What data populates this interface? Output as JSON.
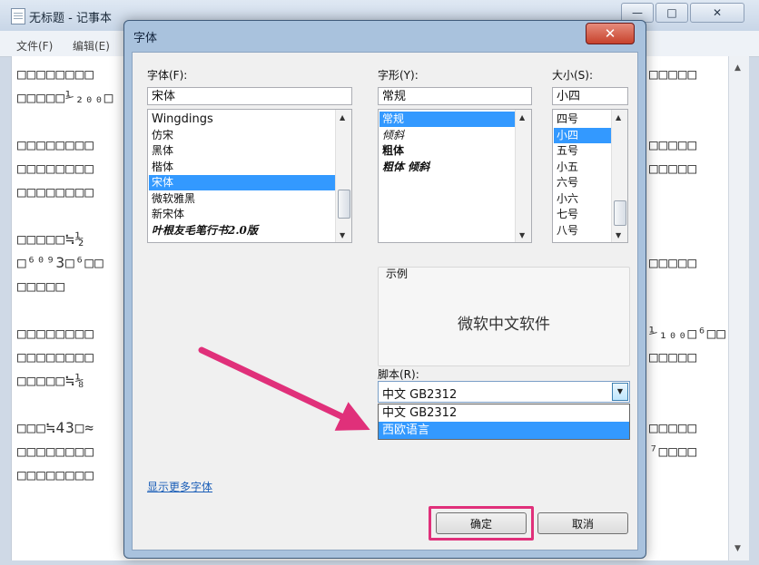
{
  "notepad": {
    "title": "无标题 - 记事本",
    "menu": [
      "文件(F)",
      "编辑(E)"
    ],
    "controls": {
      "minimize": "—",
      "maximize": "□",
      "close": "✕"
    },
    "left_lines": [
      "□□□□□□□□",
      "□□□□□⅟₂₀₀□",
      "",
      "□□□□□□□□",
      "□□□□□□□□",
      "□□□□□□□□",
      "",
      "□□□□□≒½",
      "□⁶⁰⁹3□⁶□□",
      "□□□□□",
      "",
      "□□□□□□□□",
      "□□□□□□□□",
      "□□□□□≒⅛",
      "",
      "□□□≒43□≈",
      "□□□□□□□□",
      "□□□□□□□□"
    ],
    "right_lines": [
      "□□□□□",
      "",
      "",
      "□□□□□",
      "□□□□□",
      "",
      "",
      "",
      "□□□□□",
      "",
      "",
      "⅟₁₀₀□⁶□□",
      "□□□□□",
      "",
      "",
      "□□□□□",
      "⁷□□□□",
      ""
    ]
  },
  "dialog": {
    "title": "字体",
    "close_label": "✕",
    "font": {
      "label": "字体(F):",
      "value": "宋体",
      "items": [
        "Wingdings",
        "仿宋",
        "黑体",
        "楷体",
        "宋体",
        "微软雅黑",
        "新宋体",
        "叶根友毛笔行书2.0版"
      ],
      "selected_index": 4
    },
    "style": {
      "label": "字形(Y):",
      "value": "常规",
      "items": [
        "常规",
        "倾斜",
        "粗体",
        "粗体 倾斜"
      ],
      "selected_index": 0
    },
    "size": {
      "label": "大小(S):",
      "value": "小四",
      "items": [
        "四号",
        "小四",
        "五号",
        "小五",
        "六号",
        "小六",
        "七号",
        "八号"
      ],
      "selected_index": 1
    },
    "sample": {
      "label": "示例",
      "text": "微软中文软件"
    },
    "script": {
      "label": "脚本(R):",
      "value": "中文 GB2312",
      "options": [
        "中文 GB2312",
        "西欧语言"
      ],
      "highlighted_index": 1
    },
    "more_fonts_link": "显示更多字体",
    "ok_label": "确定",
    "cancel_label": "取消"
  },
  "annotation": {
    "color": "#e0307a"
  }
}
